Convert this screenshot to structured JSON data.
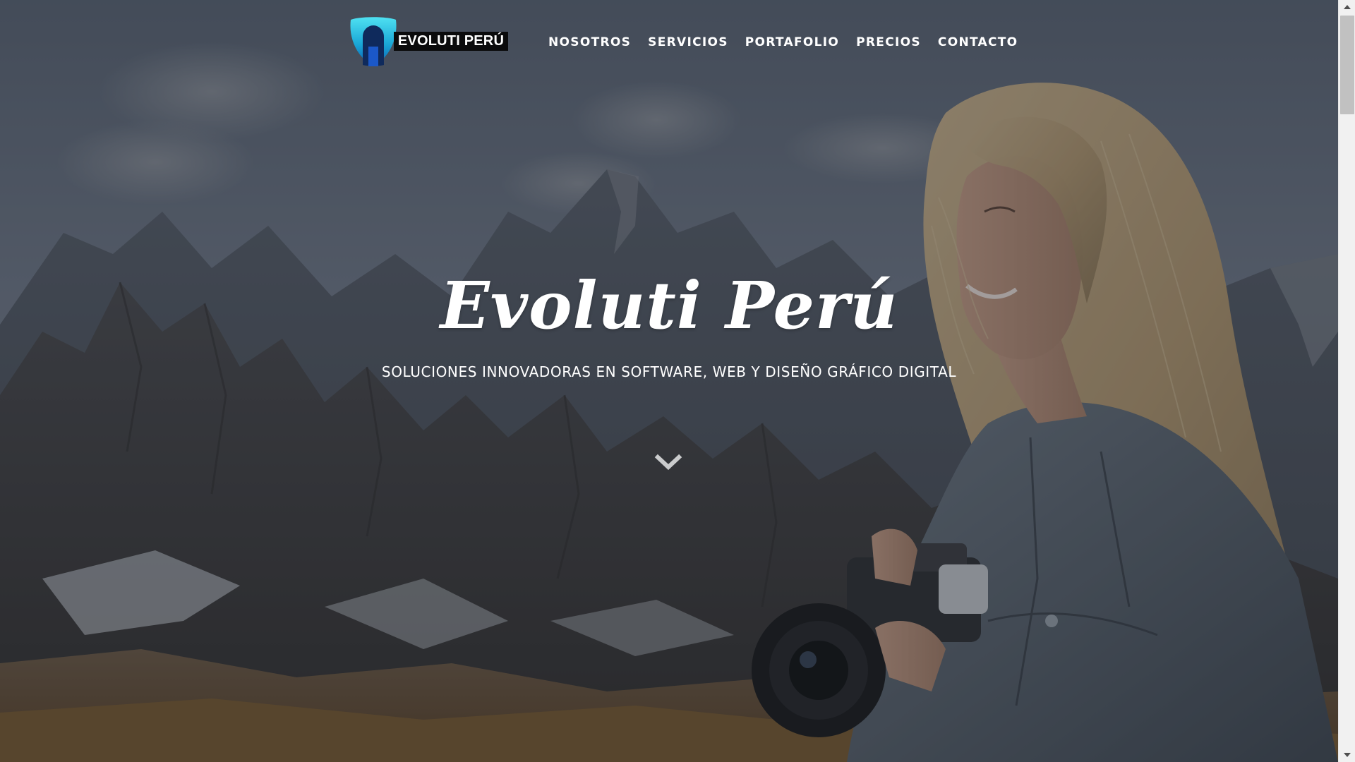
{
  "brand": {
    "name": "EVOLUTI PERÚ",
    "logo_icon": "shield-helmet-logo-icon",
    "accent_color": "#1ec8e6",
    "accent_dark": "#0a5fb4"
  },
  "nav": {
    "items": [
      {
        "label": "NOSOTROS"
      },
      {
        "label": "SERVICIOS"
      },
      {
        "label": "PORTAFOLIO"
      },
      {
        "label": "PRECIOS"
      },
      {
        "label": "CONTACTO"
      }
    ]
  },
  "hero": {
    "title": "Evoluti Perú",
    "subtitle": "SOLUCIONES INNOVADORAS EN SOFTWARE, WEB Y DISEÑO GRÁFICO DIGITAL",
    "scroll_icon": "chevron-down-icon",
    "background": "mountains-and-woman-with-camera-photo"
  },
  "scrollbar": {
    "up_icon": "scroll-up-arrow-icon",
    "down_icon": "scroll-down-arrow-icon",
    "position": 0
  }
}
